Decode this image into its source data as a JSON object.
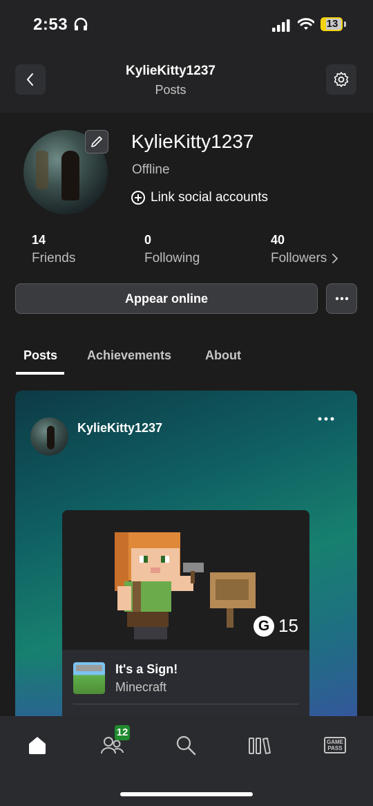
{
  "status_bar": {
    "time": "2:53",
    "battery": "13"
  },
  "header": {
    "title": "KylieKitty1237",
    "subtitle": "Posts"
  },
  "profile": {
    "name": "KylieKitty1237",
    "presence": "Offline",
    "link_social": "Link social accounts",
    "stats": {
      "friends": {
        "value": "14",
        "label": "Friends"
      },
      "following": {
        "value": "0",
        "label": "Following"
      },
      "followers": {
        "value": "40",
        "label": "Followers"
      }
    },
    "appear_online": "Appear online"
  },
  "tabs": [
    {
      "label": "Posts",
      "active": true
    },
    {
      "label": "Achievements",
      "active": false
    },
    {
      "label": "About",
      "active": false
    }
  ],
  "post": {
    "username": "KylieKitty1237",
    "achievement": {
      "title": "It's a Sign!",
      "game": "Minecraft",
      "gamerscore_symbol": "G",
      "gamerscore": "15"
    }
  },
  "bottom_nav": {
    "items": [
      "home-icon",
      "people-icon",
      "search-icon",
      "library-icon",
      "game-pass-icon"
    ],
    "people_badge": "12",
    "game_pass_text": "GAME PASS"
  },
  "colors": {
    "background": "#1c1c1d",
    "badge_green": "#1f8a2e",
    "post_gradient_start": "#0e3a45",
    "post_gradient_end": "#3b4fa3"
  }
}
